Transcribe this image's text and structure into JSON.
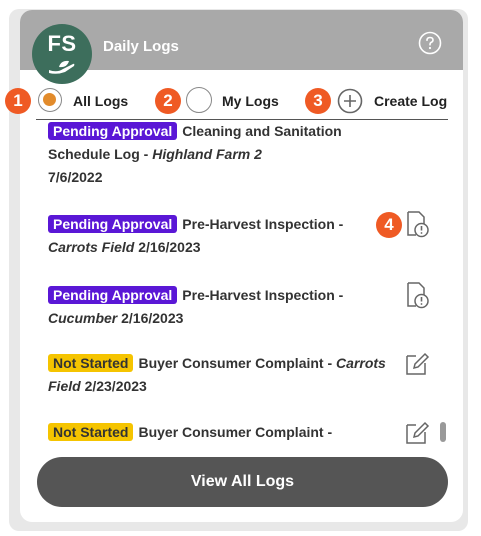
{
  "widget": {
    "logo_initials": "FS",
    "title": "Daily Logs",
    "icons": {
      "help": "help-circle-icon",
      "logo": "leaf-hand-icon"
    }
  },
  "tabs": [
    {
      "label": "All Logs",
      "selected": true,
      "callout": "1"
    },
    {
      "label": "My Logs",
      "selected": false,
      "callout": "2"
    },
    {
      "label": "Create Log",
      "icon": "plus-circle-icon",
      "callout": "3"
    }
  ],
  "logs": [
    {
      "status": "Pending Approval",
      "title": "Cleaning and Sanitation Schedule Log - ",
      "location": "Highland Farm 2",
      "date": "7/6/2022",
      "icon": "none"
    },
    {
      "status": "Pending Approval",
      "title": "Pre-Harvest Inspection - ",
      "location": "Carrots Field",
      "date": "2/16/2023",
      "icon": "document-alert-icon",
      "callout": "4"
    },
    {
      "status": "Pending Approval",
      "title": "Pre-Harvest Inspection - ",
      "location": "Cucumber",
      "date": "2/16/2023",
      "icon": "document-alert-icon"
    },
    {
      "status": "Not Started",
      "title": "Buyer Consumer Complaint - ",
      "location": "Carrots Field",
      "date": "2/23/2023",
      "icon": "edit-icon"
    },
    {
      "status": "Not Started",
      "title": "Buyer Consumer Complaint -",
      "location": "",
      "date": "",
      "icon": "edit-icon"
    }
  ],
  "footer": {
    "view_all_label": "View All Logs"
  },
  "colors": {
    "pending": "#5a17d6",
    "not_started": "#f5c400",
    "accent": "#e28b2b",
    "callout": "#ef5a24",
    "logo_bg": "#3d6e5c"
  }
}
